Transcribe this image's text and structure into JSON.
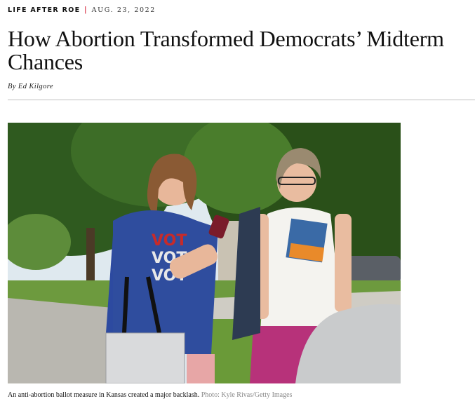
{
  "article": {
    "section": "LIFE AFTER ROE",
    "separator": "|",
    "date": "AUG. 23, 2022",
    "headline": "How Abortion Transformed Democrats’ Midterm Chances",
    "byline_prefix": "By",
    "author": "Ed Kilgore"
  },
  "photo": {
    "caption": "An anti-abortion ballot measure in Kansas created a major backlash.",
    "credit": "Photo: Kyle Rivas/Getty Images",
    "tshirt_text": [
      "VOT",
      "VOT",
      "VOT"
    ]
  },
  "colors": {
    "rubric_separator": "#d0021b",
    "rule": "#bfbfbf",
    "credit": "#888888"
  }
}
